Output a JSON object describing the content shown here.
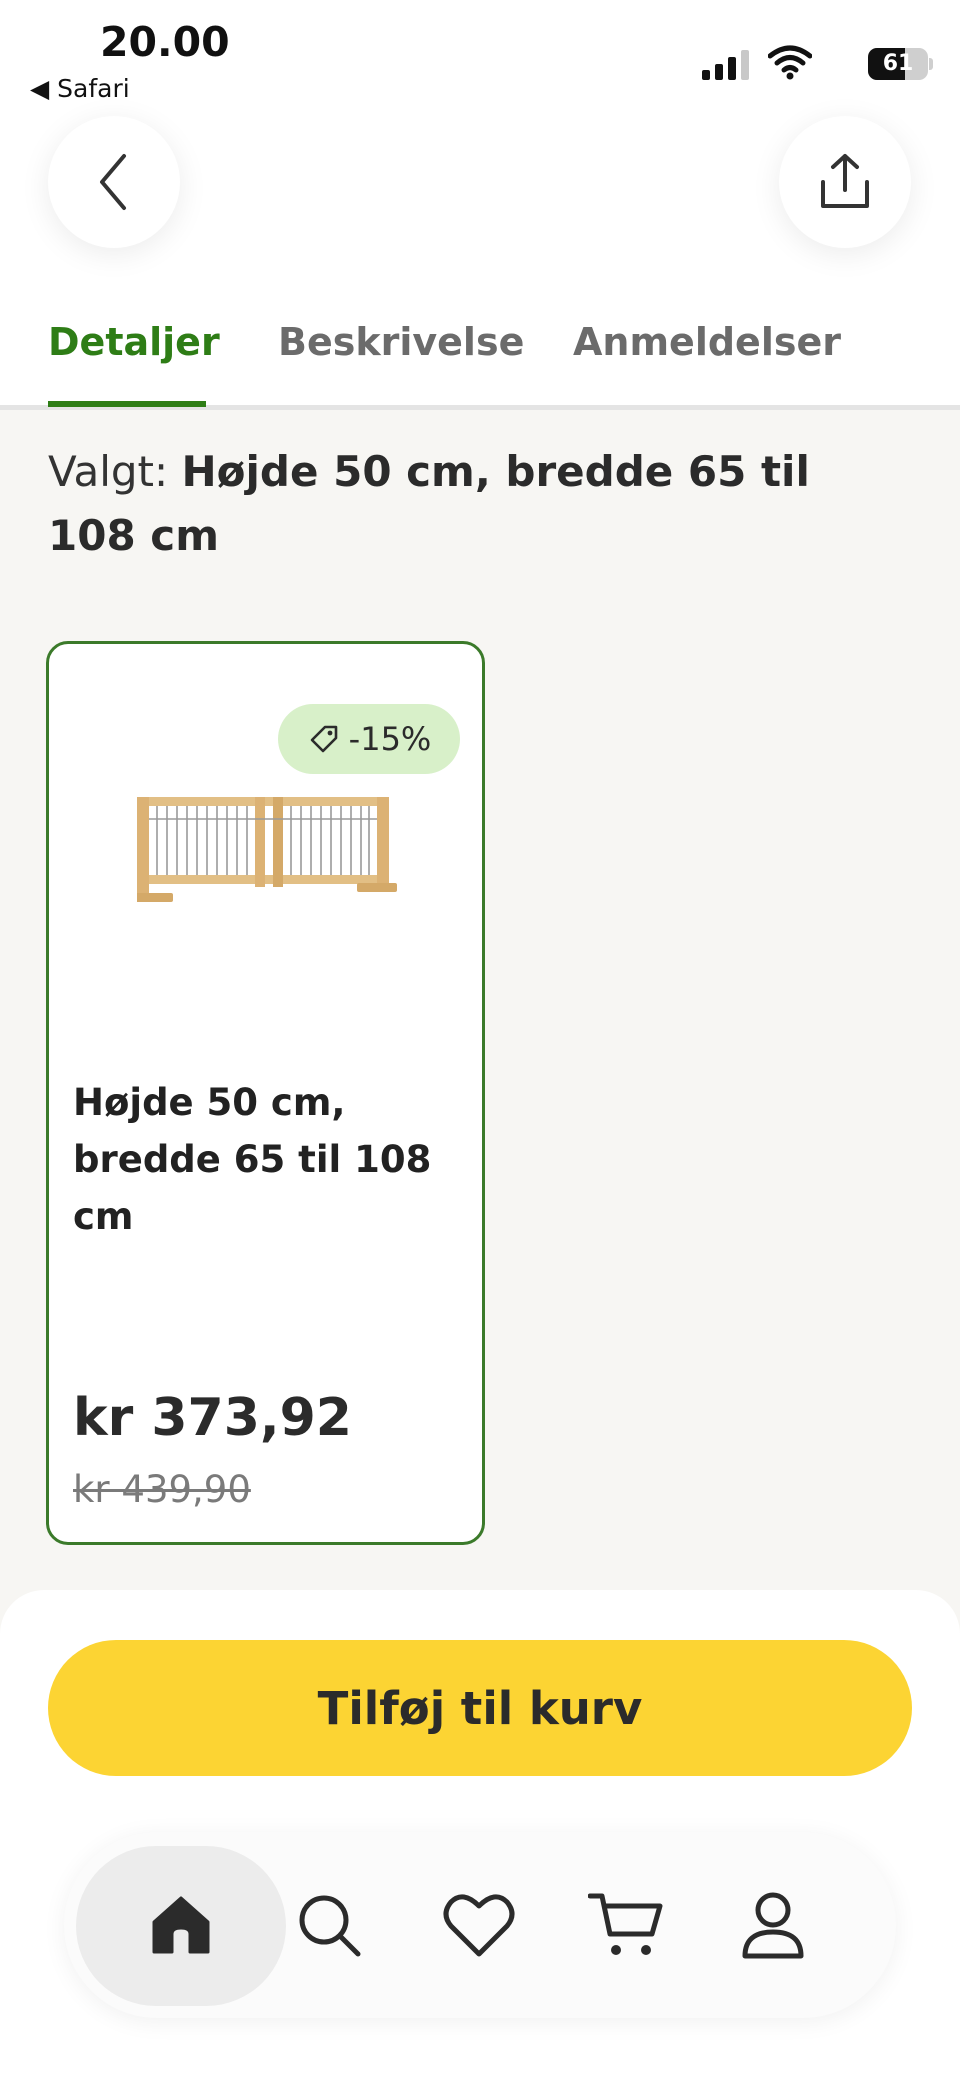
{
  "status_bar": {
    "time": "20.00",
    "back_app": "◀ Safari",
    "battery": "61",
    "battery_level": 0.61
  },
  "header": {
    "back_icon": "chevron-left-icon",
    "share_icon": "share-icon"
  },
  "tabs": [
    {
      "label": "Detaljer",
      "active": true
    },
    {
      "label": "Beskrivelse",
      "active": false
    },
    {
      "label": "Anmeldelser",
      "active": false
    }
  ],
  "selection": {
    "prefix": "Valgt:",
    "value": "Højde 50 cm, bredde 65 til 108 cm"
  },
  "variant": {
    "discount": "-15%",
    "name": "Højde 50 cm, bredde 65 til 108 cm",
    "price": "kr 373,92",
    "old_price": "kr 439,90"
  },
  "actions": {
    "add_to_cart": "Tilføj til kurv"
  },
  "nav": [
    {
      "icon": "home-icon",
      "active": true
    },
    {
      "icon": "search-icon",
      "active": false
    },
    {
      "icon": "heart-icon",
      "active": false
    },
    {
      "icon": "cart-icon",
      "active": false
    },
    {
      "icon": "profile-icon",
      "active": false
    }
  ],
  "colors": {
    "accent_green": "#2e7d16",
    "card_border": "#3b7a2a",
    "badge_bg": "#d8f0c9",
    "cta_yellow": "#fcd433",
    "page_bg": "#f7f6f3"
  }
}
